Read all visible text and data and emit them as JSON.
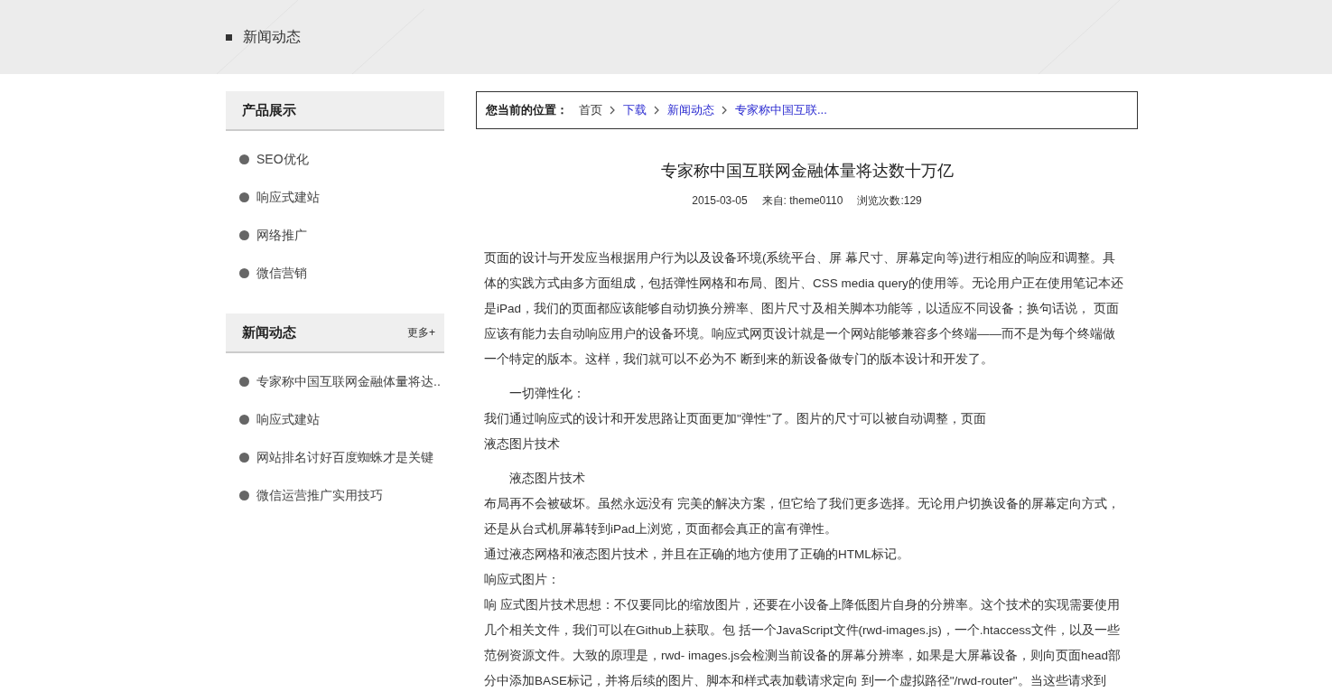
{
  "header": {
    "title": "新闻动态"
  },
  "sidebar": [
    {
      "title": "产品展示",
      "items": [
        "SEO优化",
        "响应式建站",
        "网络推广",
        "微信营销"
      ]
    },
    {
      "title": "新闻动态",
      "more": "更多+",
      "items": [
        "专家称中国互联网金融体量将达..",
        "响应式建站",
        "网站排名讨好百度蜘蛛才是关键",
        "微信运营推广实用技巧"
      ]
    }
  ],
  "breadcrumb": {
    "label": "您当前的位置：",
    "items": [
      {
        "text": "首页",
        "kind": "plain"
      },
      {
        "text": "下载",
        "kind": "link"
      },
      {
        "text": "新闻动态",
        "kind": "link"
      },
      {
        "text": "专家称中国互联...",
        "kind": "link"
      }
    ]
  },
  "article": {
    "title": "专家称中国互联网金融体量将达数十万亿",
    "date": "2015-03-05",
    "source": "来自: theme0110",
    "views": "浏览次数:129",
    "paragraphs": [
      {
        "kind": "text",
        "text": "页面的设计与开发应当根据用户行为以及设备环境(系统平台、屏 幕尺寸、屏幕定向等)进行相应的响应和调整。具体的实践方式由多方面组成，包括弹性网格和布局、图片、CSS media query的使用等。无论用户正在使用笔记本还是iPad，我们的页面都应该能够自动切换分辨率、图片尺寸及相关脚本功能等，以适应不同设备；换句话说， 页面应该有能力去自动响应用户的设备环境。响应式网页设计就是一个网站能够兼容多个终端——而不是为每个终端做一个特定的版本。这样，我们就可以不必为不 断到来的新设备做专门的版本设计和开发了。"
      },
      {
        "kind": "indent",
        "text": "一切弹性化："
      },
      {
        "kind": "text",
        "text": "我们通过响应式的设计和开发思路让页面更加\"弹性\"了。图片的尺寸可以被自动调整，页面"
      },
      {
        "kind": "text",
        "text": "液态图片技术"
      },
      {
        "kind": "indent",
        "text": "液态图片技术"
      },
      {
        "kind": "text",
        "text": "布局再不会被破坏。虽然永远没有 完美的解决方案，但它给了我们更多选择。无论用户切换设备的屏幕定向方式，还是从台式机屏幕转到iPad上浏览，页面都会真正的富有弹性。"
      },
      {
        "kind": "text",
        "text": "通过液态网格和液态图片技术，并且在正确的地方使用了正确的HTML标记。"
      },
      {
        "kind": "text",
        "text": "响应式图片："
      },
      {
        "kind": "text",
        "text": "响 应式图片技术思想：不仅要同比的缩放图片，还要在小设备上降低图片自身的分辨率。这个技术的实现需要使用几个相关文件，我们可以在Github上获取。包 括一个JavaScript文件(rwd-images.js)，一个.htaccess文件，以及一些范例资源文件。大致的原理是，rwd- images.js会检测当前设备的屏幕分辨率，如果是大屏幕设备，则向页面head部分中添加BASE标记，并将后续的图片、脚本和样式表加载请求定向 到一个虚拟路径\"/rwd-router\"。当这些请求到"
      }
    ]
  }
}
